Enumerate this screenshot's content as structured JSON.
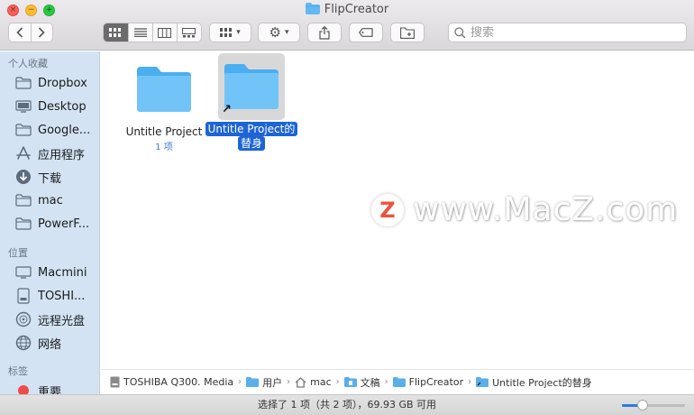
{
  "window": {
    "title": "FlipCreator"
  },
  "toolbar": {
    "search_placeholder": "搜索"
  },
  "sidebar": {
    "favorites_header": "个人收藏",
    "favorites": [
      {
        "label": "Dropbox",
        "icon": "folder-icon"
      },
      {
        "label": "Desktop",
        "icon": "desktop-icon"
      },
      {
        "label": "Google...",
        "icon": "folder-icon"
      },
      {
        "label": "应用程序",
        "icon": "applications-icon"
      },
      {
        "label": "下载",
        "icon": "download-icon"
      },
      {
        "label": "mac",
        "icon": "folder-icon"
      },
      {
        "label": "PowerF...",
        "icon": "folder-icon"
      }
    ],
    "locations_header": "位置",
    "locations": [
      {
        "label": "Macmini",
        "icon": "computer-icon"
      },
      {
        "label": "TOSHI...",
        "icon": "disk-icon"
      },
      {
        "label": "远程光盘",
        "icon": "optical-disc-icon"
      },
      {
        "label": "网络",
        "icon": "network-icon"
      }
    ],
    "tags_header": "标签",
    "tags": [
      {
        "label": "重要",
        "color": "#f14a4a"
      }
    ]
  },
  "files": [
    {
      "name": "Untitle Project",
      "sub": "1 项",
      "selected": false,
      "alias": false
    },
    {
      "name_line1": "Untitle Project的",
      "name_line2": "替身",
      "selected": true,
      "alias": true
    }
  ],
  "watermark": {
    "text": "www.MacZ.com",
    "logo_letter": "Z"
  },
  "pathbar": [
    {
      "label": "TOSHIBA Q300. Media",
      "icon": "disk-icon"
    },
    {
      "label": "用户",
      "icon": "folder-icon"
    },
    {
      "label": "mac",
      "icon": "home-icon"
    },
    {
      "label": "文稿",
      "icon": "documents-icon"
    },
    {
      "label": "FlipCreator",
      "icon": "folder-icon"
    },
    {
      "label": "Untitle Project的替身",
      "icon": "alias-folder-icon"
    }
  ],
  "statusbar": {
    "text": "选择了 1 项（共 2 项），69.93 GB 可用",
    "zoom_level": 0.3
  },
  "colors": {
    "accent": "#1d64d6",
    "folder": "#63b8f4",
    "sidebar_bg": "#d3e3f3"
  }
}
